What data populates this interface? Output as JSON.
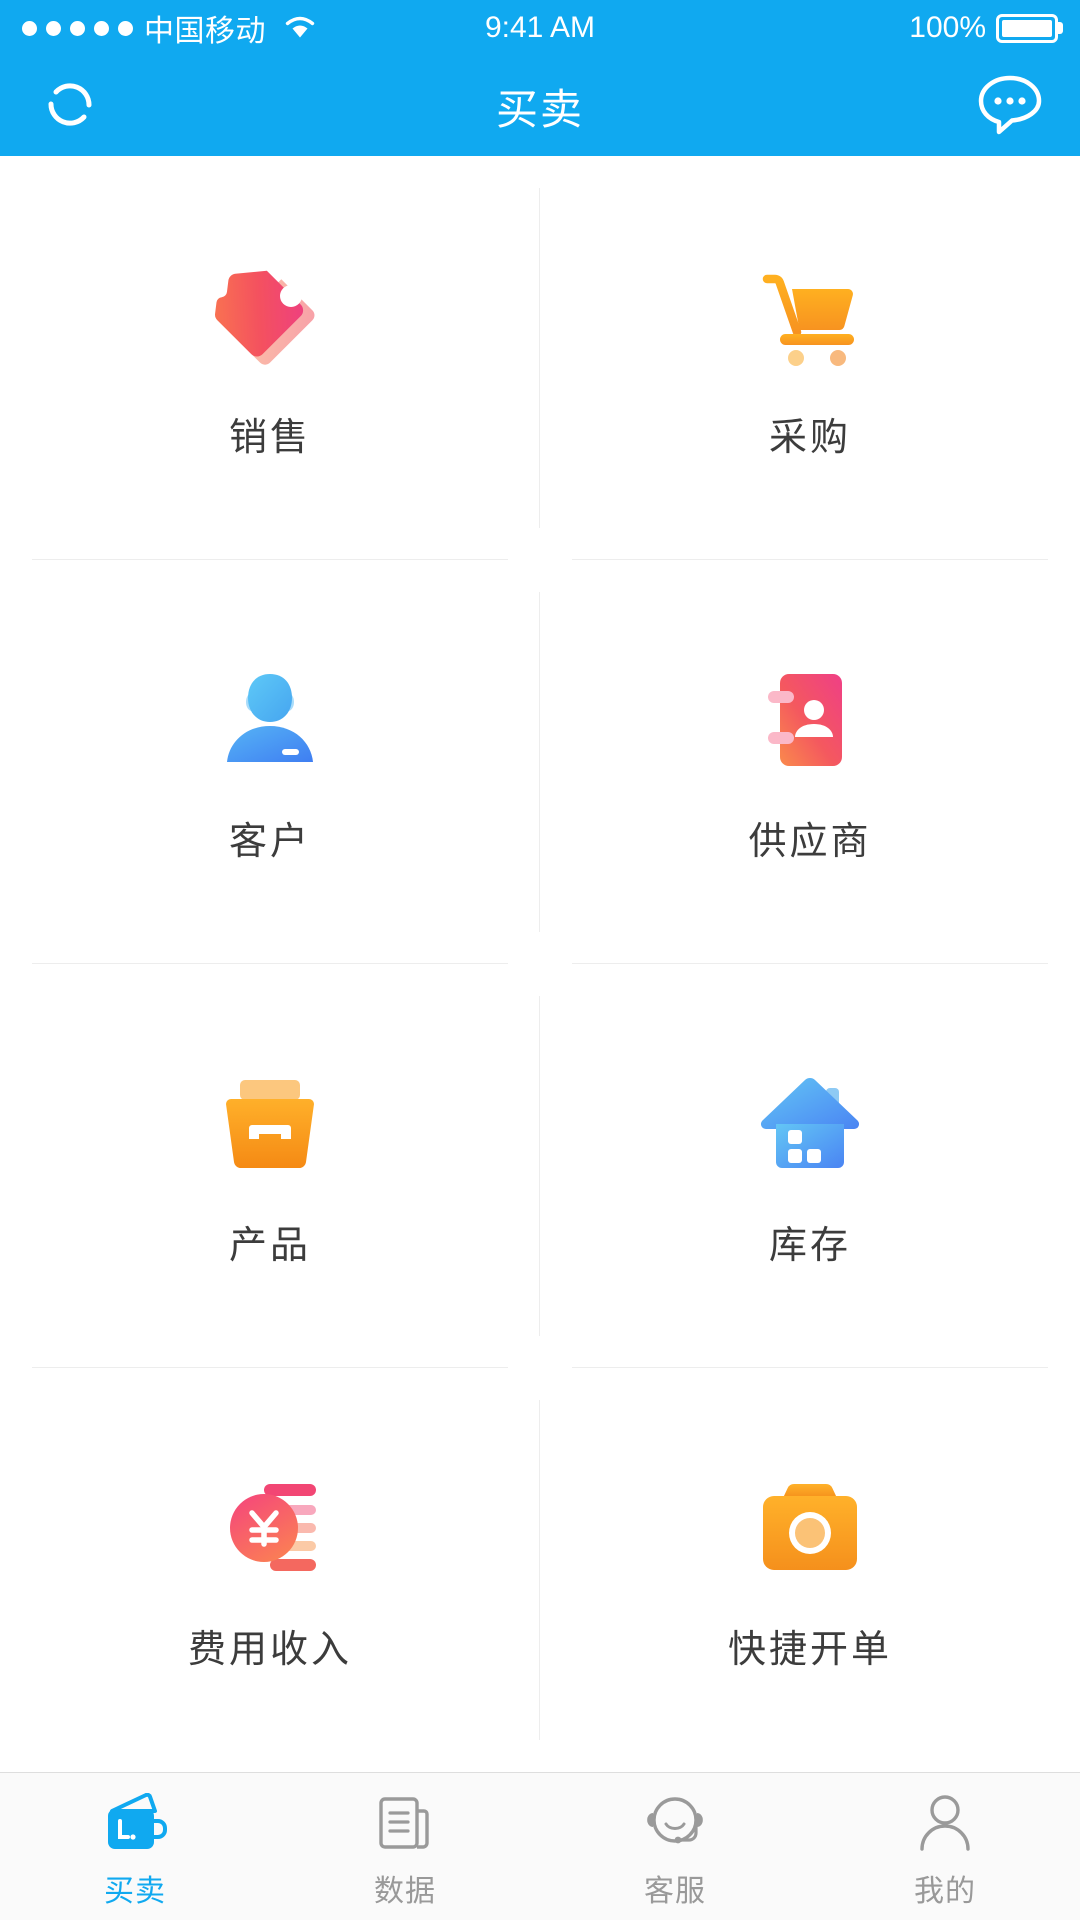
{
  "theme": {
    "brand_blue": "#10a9f0",
    "tab_active": "#10a9f0",
    "tab_inactive": "#999999",
    "label_color": "#3c3c3c",
    "divider": "#ededed",
    "tabbar_bg": "#fafafa"
  },
  "statusbar": {
    "carrier": "中国移动",
    "signal_icon": "signal-dots-icon",
    "wifi_icon": "wifi-icon",
    "time": "9:41 AM",
    "battery_percent": "100%",
    "battery_icon": "battery-full-icon"
  },
  "navbar": {
    "title": "买卖",
    "left_icon": "refresh-icon",
    "right_icon": "message-bubble-icon"
  },
  "grid": {
    "items": [
      {
        "label": "销售",
        "icon": "price-tag-icon"
      },
      {
        "label": "采购",
        "icon": "shopping-cart-icon"
      },
      {
        "label": "客户",
        "icon": "customer-person-icon"
      },
      {
        "label": "供应商",
        "icon": "address-book-icon"
      },
      {
        "label": "产品",
        "icon": "storage-box-icon"
      },
      {
        "label": "库存",
        "icon": "warehouse-house-icon"
      },
      {
        "label": "费用收入",
        "icon": "yuan-coin-icon"
      },
      {
        "label": "快捷开单",
        "icon": "camera-icon"
      }
    ]
  },
  "tabbar": {
    "tabs": [
      {
        "label": "买卖",
        "icon": "wallet-icon",
        "active": true
      },
      {
        "label": "数据",
        "icon": "document-icon",
        "active": false
      },
      {
        "label": "客服",
        "icon": "headset-icon",
        "active": false
      },
      {
        "label": "我的",
        "icon": "person-icon",
        "active": false
      }
    ]
  }
}
